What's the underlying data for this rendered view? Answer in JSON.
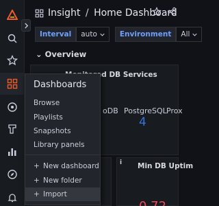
{
  "header": {
    "folder": "Insight",
    "separator": "/",
    "dashboard": "Home Dashboard"
  },
  "variables": [
    {
      "label": "Interval",
      "value": "auto"
    },
    {
      "label": "Environment",
      "value": "All"
    }
  ],
  "row": {
    "title": "Overview"
  },
  "panels": {
    "services": {
      "title": "Monitored DB Services",
      "labels": [
        "oDB",
        "PostgreSQL",
        "Prox"
      ],
      "values": [
        "4"
      ]
    },
    "uptime": {
      "title": "Min DB Uptim",
      "info": "i",
      "value_fragment": "0 72"
    }
  },
  "dashboards_menu": {
    "title": "Dashboards",
    "items": [
      "Browse",
      "Playlists",
      "Snapshots",
      "Library panels"
    ],
    "actions": [
      "New dashboard",
      "New folder",
      "Import"
    ]
  },
  "colors": {
    "accent": "#6e9fff",
    "stat_blue": "#3274d9",
    "stat_red": "#f2495c",
    "stat_green": "#73bf69",
    "brand": "#f05a28"
  }
}
